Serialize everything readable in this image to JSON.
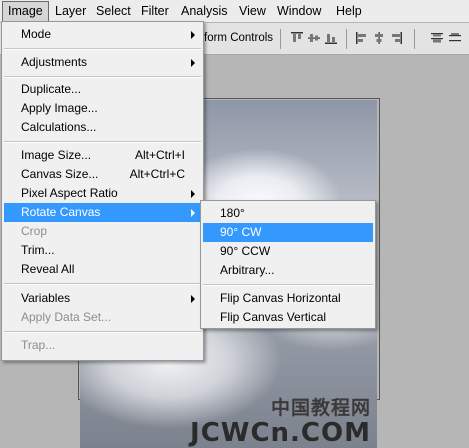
{
  "menubar": {
    "items": [
      "Image",
      "Layer",
      "Select",
      "Filter",
      "Analysis",
      "View",
      "Window",
      "Help"
    ],
    "active": "Image"
  },
  "options_bar": {
    "label_fragment": "form Controls",
    "icons": [
      "align-top-edges-icon",
      "align-vertical-centers-icon",
      "align-bottom-edges-icon",
      "align-left-edges-icon",
      "align-horizontal-centers-icon",
      "align-right-edges-icon",
      "distribute-top-edges-icon"
    ]
  },
  "image_menu": {
    "items": [
      {
        "label": "Mode",
        "submenu": true
      },
      {
        "divider": true
      },
      {
        "label": "Adjustments",
        "submenu": true
      },
      {
        "divider": true
      },
      {
        "label": "Duplicate..."
      },
      {
        "label": "Apply Image..."
      },
      {
        "label": "Calculations..."
      },
      {
        "divider": true
      },
      {
        "label": "Image Size...",
        "shortcut": "Alt+Ctrl+I"
      },
      {
        "label": "Canvas Size...",
        "shortcut": "Alt+Ctrl+C"
      },
      {
        "label": "Pixel Aspect Ratio",
        "submenu": true
      },
      {
        "label": "Rotate Canvas",
        "submenu": true,
        "highlighted": true
      },
      {
        "label": "Crop",
        "disabled": true
      },
      {
        "label": "Trim..."
      },
      {
        "label": "Reveal All"
      },
      {
        "divider": true
      },
      {
        "label": "Variables",
        "submenu": true
      },
      {
        "label": "Apply Data Set...",
        "disabled": true
      },
      {
        "divider": true
      },
      {
        "label": "Trap...",
        "disabled": true
      }
    ]
  },
  "rotate_submenu": {
    "items": [
      {
        "label": "180°"
      },
      {
        "label": "90° CW",
        "highlighted": true
      },
      {
        "label": "90° CCW"
      },
      {
        "label": "Arbitrary..."
      },
      {
        "divider": true
      },
      {
        "label": "Flip Canvas Horizontal"
      },
      {
        "label": "Flip Canvas Vertical"
      }
    ]
  },
  "watermark": {
    "cn": "中国教程网",
    "en": "JCWCn.COM"
  },
  "colors": {
    "highlight": "#3399ff",
    "menu_bg": "#f0f0f0",
    "disabled_text": "#8d8d8d"
  }
}
